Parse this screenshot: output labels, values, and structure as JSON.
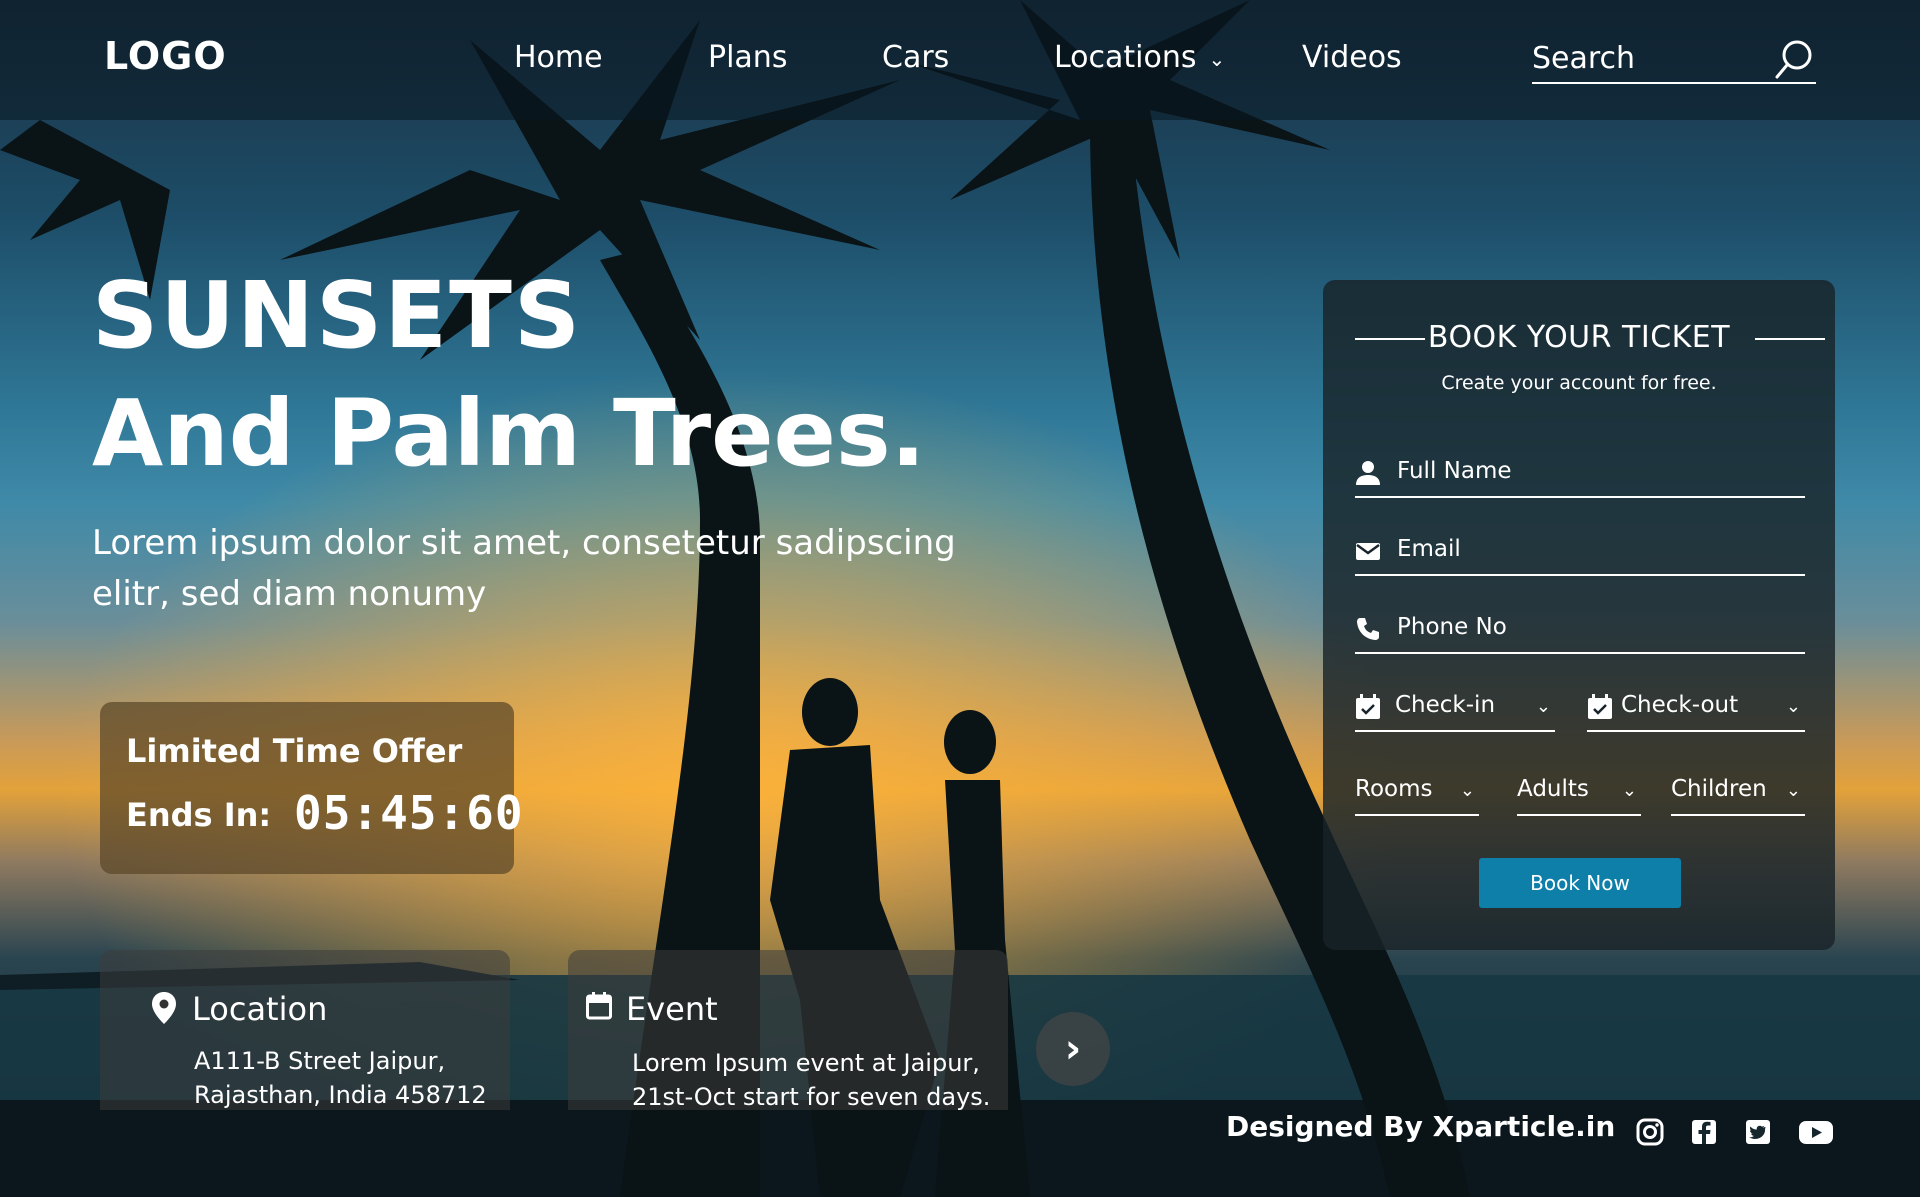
{
  "nav": {
    "logo": "LOGO",
    "links": [
      "Home",
      "Plans",
      "Cars",
      "Locations",
      "Videos"
    ],
    "search_placeholder": "Search"
  },
  "hero": {
    "title_line1": "SUNSETS",
    "title_line2": "And Palm Trees.",
    "subtitle": "Lorem ipsum dolor sit amet, consetetur sadipscing elitr, sed diam nonumy"
  },
  "offer": {
    "title": "Limited Time Offer",
    "label": "Ends In:",
    "timer": "05:45:60"
  },
  "cards": {
    "location": {
      "title": "Location",
      "line1": "A111-B Street Jaipur,",
      "line2": "Rajasthan, India 458712"
    },
    "event": {
      "title": "Event",
      "line1": "Lorem Ipsum event at Jaipur,",
      "line2": "21st-Oct start for seven days."
    }
  },
  "booking": {
    "title": "BOOK YOUR TICKET",
    "subtitle": "Create your account for free.",
    "full_name": "Full Name",
    "email": "Email",
    "phone": "Phone No",
    "check_in": "Check-in",
    "check_out": "Check-out",
    "rooms": "Rooms",
    "adults": "Adults",
    "children": "Children",
    "button": "Book Now"
  },
  "footer": {
    "credit": "Designed By Xparticle.in",
    "social_icons": [
      "instagram-icon",
      "facebook-icon",
      "twitter-icon",
      "youtube-icon"
    ]
  },
  "colors": {
    "accent": "#0e7fa8",
    "panel": "#19232b"
  }
}
